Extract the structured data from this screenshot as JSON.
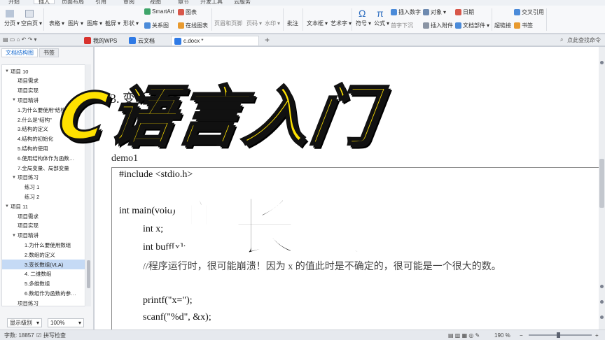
{
  "menubar": {
    "items": [
      "开始",
      "插入",
      "页面布局",
      "引用",
      "审阅",
      "视图",
      "章节",
      "开发工具",
      "云服务"
    ],
    "active": "插入"
  },
  "ribbon": {
    "items": [
      "分页",
      "空白页",
      "表格",
      "图片",
      "图库",
      "截屏",
      "形状",
      "SmartArt",
      "图表",
      "关系图",
      "在线图表",
      "页眉和页脚",
      "页码",
      "水印",
      "批注",
      "文本框",
      "艺术字",
      "符号",
      "公式",
      "首字下沉",
      "插入数字",
      "对象",
      "插入附件",
      "日期",
      "文档部件",
      "超链接",
      "交叉引用",
      "书签"
    ]
  },
  "tabs": {
    "wps": "我的WPS",
    "cloud": "云文档",
    "doc": "c.docx *",
    "add": "+",
    "search": "点此查找命令"
  },
  "leftpane": {
    "tab_nav": "文档结构图",
    "tab_bookmark": "书签",
    "tree": [
      {
        "label": "项目 10",
        "level": 0,
        "expand": "▼"
      },
      {
        "label": "项目需求",
        "level": 1
      },
      {
        "label": "项目实现",
        "level": 1
      },
      {
        "label": "项目精讲",
        "level": 1,
        "expand": "▼"
      },
      {
        "label": "1.为什么要使用“结构…",
        "level": 1
      },
      {
        "label": "2.什么是“结构”",
        "level": 1
      },
      {
        "label": "3.结构的定义",
        "level": 1
      },
      {
        "label": "4.结构的初始化",
        "level": 1
      },
      {
        "label": "5.结构的使用",
        "level": 1
      },
      {
        "label": "6.使用结构体作为函数…",
        "level": 1
      },
      {
        "label": "7.全局变量、局部变量",
        "level": 1
      },
      {
        "label": "项目练习",
        "level": 1,
        "expand": "▼"
      },
      {
        "label": "练习 1",
        "level": 2
      },
      {
        "label": "练习 2",
        "level": 2
      },
      {
        "label": "项目 11",
        "level": 0,
        "expand": "▼"
      },
      {
        "label": "项目需求",
        "level": 1
      },
      {
        "label": "项目实现",
        "level": 1
      },
      {
        "label": "项目精讲",
        "level": 1,
        "expand": "▼"
      },
      {
        "label": "1.为什么要使用数组",
        "level": 2
      },
      {
        "label": "2.数组的定义",
        "level": 2
      },
      {
        "label": "3.变长数组(VLA)",
        "level": 2,
        "selected": true
      },
      {
        "label": "4. 二维数组",
        "level": 2
      },
      {
        "label": "5.多维数组",
        "level": 2
      },
      {
        "label": "6.数组作为函数的参…",
        "level": 2
      },
      {
        "label": "项目练习",
        "level": 1
      }
    ],
    "level_select": "显示级别",
    "zoom_select": "100%"
  },
  "document": {
    "heading_fragment": "3. 变长                 A)",
    "demo_label": "demo1",
    "code": [
      "#include <stdio.h>",
      "",
      "int main(void)",
      "int x;",
      "int buff[x];",
      "//程序运行时，很可能崩溃！因为 x 的值此时是不确定的，很可能是一个很大的数。",
      "",
      "printf(\"x=\");",
      "scanf(\"%d\", &x);"
    ]
  },
  "overlay": {
    "title": "C语言入门",
    "subtitle": "变长数组"
  },
  "status": {
    "wordcount": "字数: 18857",
    "spellcheck": "拼写检查",
    "zoom": "190 %"
  }
}
